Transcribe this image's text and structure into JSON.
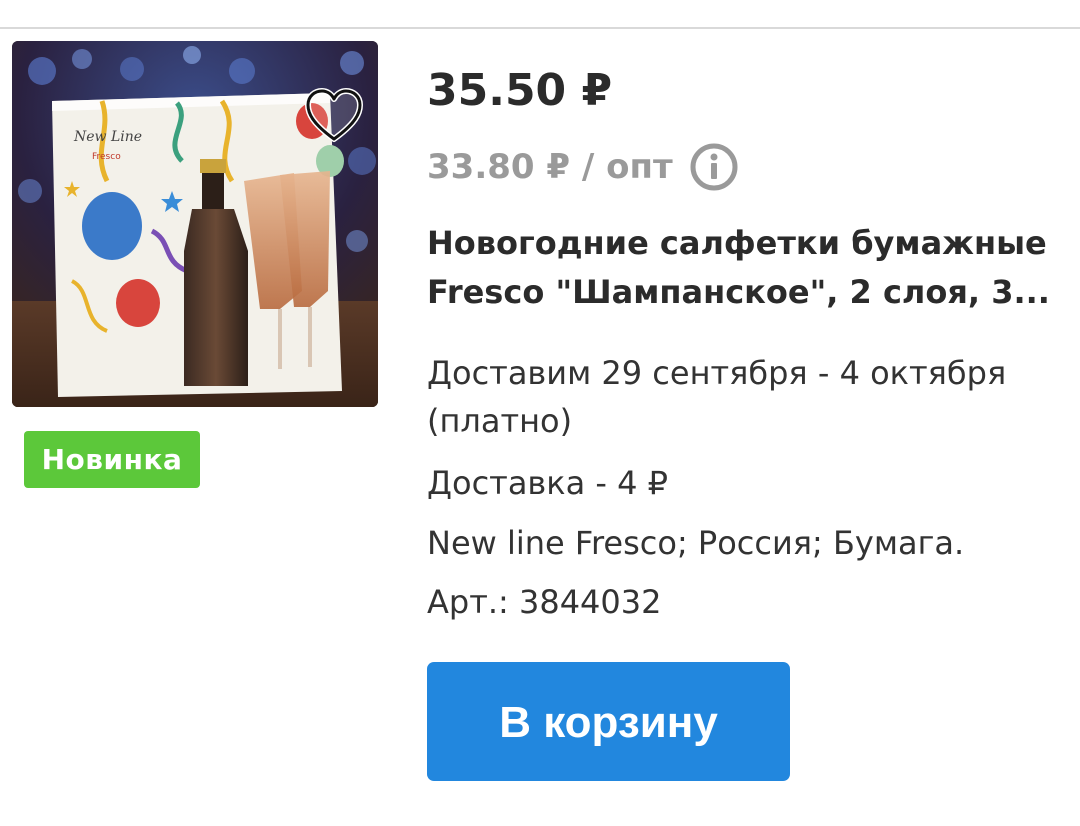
{
  "product": {
    "price": "35.50 ₽",
    "wholesale_price": "33.80 ₽ / опт",
    "badge": "Новинка",
    "title_lines": [
      "Новогодние салфетки бумажные",
      "Fresco \"Шампанское\", 2 слоя, 3..."
    ],
    "image_brand_text": "New Line",
    "image_brand_sub": "Fresco",
    "delivery_date_lines": [
      "Доставим 29 сентября - 4 октября",
      "(платно)"
    ],
    "delivery_cost": "Доставка - 4 ₽",
    "attributes": "New line Fresco; Россия; Бумага.",
    "article": "Арт.: 3844032",
    "add_to_cart_label": "В корзину"
  },
  "icons": {
    "favorite": "heart-outline-icon",
    "info": "info-circle-icon"
  },
  "colors": {
    "badge": "#5cc83a",
    "button": "#2287de",
    "muted_text": "#9a9a9a",
    "main_text": "#2b2b2b"
  }
}
